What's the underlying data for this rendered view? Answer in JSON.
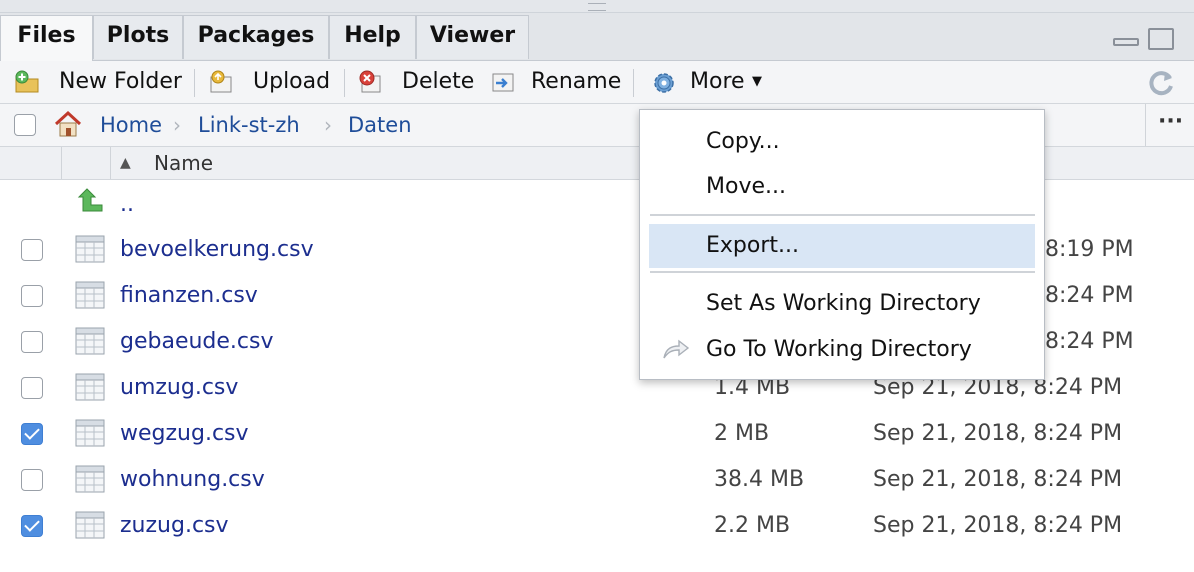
{
  "tabs": [
    {
      "label": "Files",
      "active": true
    },
    {
      "label": "Plots",
      "active": false
    },
    {
      "label": "Packages",
      "active": false
    },
    {
      "label": "Help",
      "active": false
    },
    {
      "label": "Viewer",
      "active": false
    }
  ],
  "toolbar": {
    "new_folder": "New Folder",
    "upload": "Upload",
    "delete": "Delete",
    "rename": "Rename",
    "more": "More"
  },
  "breadcrumb": [
    "Home",
    "Link-st-zh",
    "Daten"
  ],
  "column_header": {
    "name": "Name"
  },
  "parent_dir": "..",
  "files": [
    {
      "name": "bevoelkerung.csv",
      "size": "",
      "modified": "8:19 PM",
      "checked": false
    },
    {
      "name": "finanzen.csv",
      "size": "",
      "modified": "8:24 PM",
      "checked": false
    },
    {
      "name": "gebaeude.csv",
      "size": "",
      "modified": "8:24 PM",
      "checked": false
    },
    {
      "name": "umzug.csv",
      "size": "1.4 MB",
      "modified": "Sep 21, 2018, 8:24 PM",
      "checked": false
    },
    {
      "name": "wegzug.csv",
      "size": "2 MB",
      "modified": "Sep 21, 2018, 8:24 PM",
      "checked": true
    },
    {
      "name": "wohnung.csv",
      "size": "38.4 MB",
      "modified": "Sep 21, 2018, 8:24 PM",
      "checked": false
    },
    {
      "name": "zuzug.csv",
      "size": "2.2 MB",
      "modified": "Sep 21, 2018, 8:24 PM",
      "checked": true
    }
  ],
  "menu": {
    "copy": "Copy...",
    "move": "Move...",
    "export": "Export...",
    "set_wd": "Set As Working Directory",
    "go_wd": "Go To Working Directory"
  },
  "colors": {
    "link": "#1c2e8f",
    "highlight": "#d9e6f5",
    "checkbox_checked": "#4f8ee0"
  }
}
